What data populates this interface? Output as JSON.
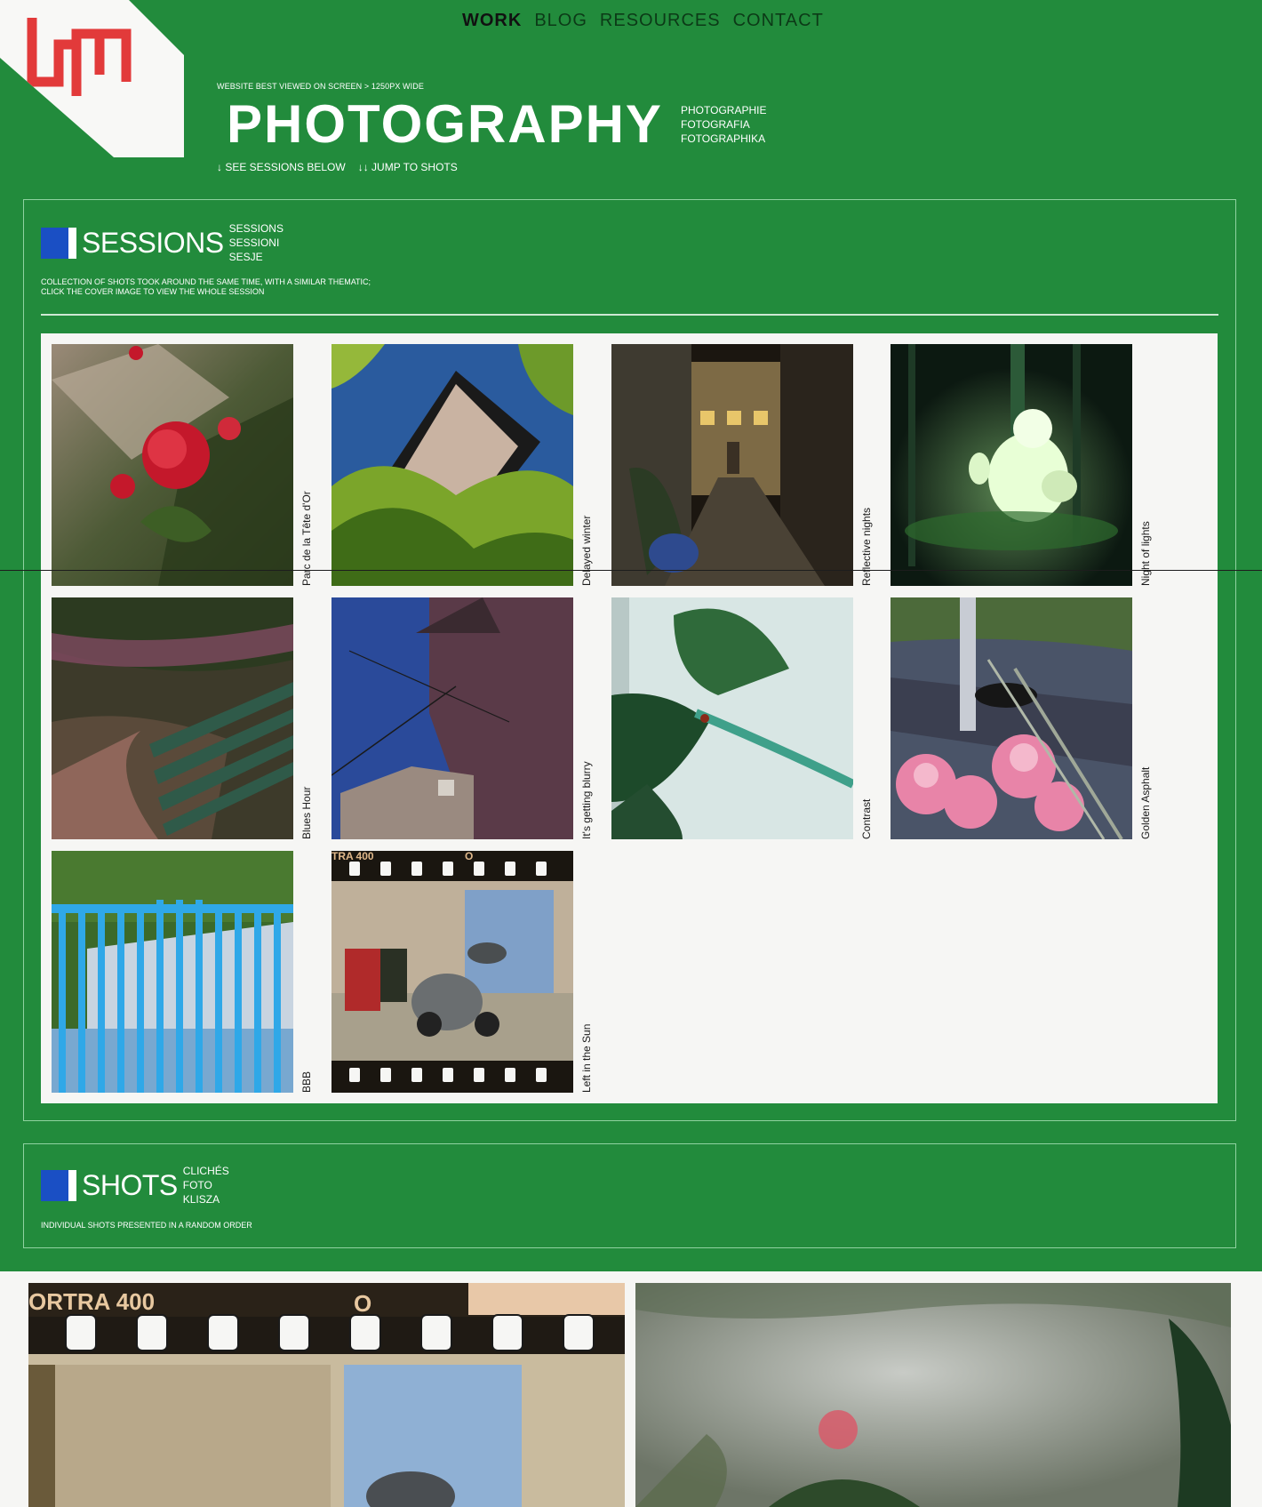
{
  "nav": {
    "items": [
      {
        "label": "WORK",
        "active": true
      },
      {
        "label": "BLOG",
        "active": false
      },
      {
        "label": "RESOURCES",
        "active": false
      },
      {
        "label": "CONTACT",
        "active": false
      }
    ]
  },
  "logo": {
    "name": "logo-icon",
    "color": "#e23a3a"
  },
  "hero": {
    "best_viewed": "WEBSITE BEST VIEWED ON SCREEN > 1250PX WIDE",
    "title": "PHOTOGRAPHY",
    "translations": [
      "PHOTOGRAPHIE",
      "FOTOGRAFIA",
      "FOTOGRAPHIKA"
    ],
    "link_sessions": "↓ SEE SESSIONS BELOW",
    "link_shots": "↓↓ JUMP TO SHOTS"
  },
  "sessions": {
    "title": "SESSIONS",
    "translations": [
      "SESSIONS",
      "SESSIONI",
      "SESJE"
    ],
    "description_line1": "COLLECTION OF SHOTS TOOK AROUND THE SAME TIME, WITH A SIMILAR THEMATIC;",
    "description_line2": "CLICK THE COVER IMAGE TO VIEW THE WHOLE SESSION",
    "items": [
      {
        "label": "Parc de la Tête d'Or",
        "icon": "rose-photo"
      },
      {
        "label": "Delayed winter",
        "icon": "house-leaves-photo"
      },
      {
        "label": "Reflective nights",
        "icon": "night-alley-photo"
      },
      {
        "label": "Night of lights",
        "icon": "glowing-bear-photo"
      },
      {
        "label": "Blues Hour",
        "icon": "park-bench-photo"
      },
      {
        "label": "It's getting blurry",
        "icon": "building-wires-photo"
      },
      {
        "label": "Contrast",
        "icon": "leaf-ladybug-photo"
      },
      {
        "label": "Golden Asphalt",
        "icon": "pink-flowers-photo"
      },
      {
        "label": "BBB",
        "icon": "blue-fence-photo"
      },
      {
        "label": "Left in the Sun",
        "icon": "scooter-film-photo"
      }
    ]
  },
  "shots": {
    "title": "SHOTS",
    "translations": [
      "CLICHÉS",
      "FOTO",
      "KLISZA"
    ],
    "description": "INDIVIDUAL SHOTS PRESENTED IN A RANDOM ORDER",
    "film_text": "ORTRA 400",
    "film_mark": "O",
    "film_text_small": "TRA 400"
  },
  "colors": {
    "background": "#228b3c",
    "accent_blue": "#1a4fc4",
    "panel_bg": "#f6f6f4"
  }
}
